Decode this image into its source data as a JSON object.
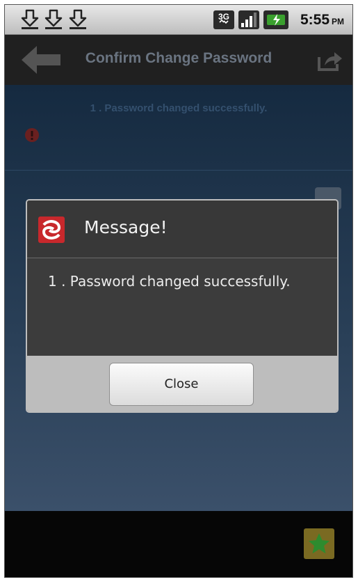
{
  "status_bar": {
    "time": "5:55",
    "ampm": "PM",
    "network": "3G"
  },
  "title_bar": {
    "title": "Confirm Change Password"
  },
  "content": {
    "message": "1 . Password changed successfully."
  },
  "dialog": {
    "title": "Message!",
    "body": "1 . Password changed successfully.",
    "close_label": "Close"
  },
  "colors": {
    "accent_red": "#c8282c",
    "battery_green": "#3aa02e",
    "star_green": "#2e8b2e"
  }
}
